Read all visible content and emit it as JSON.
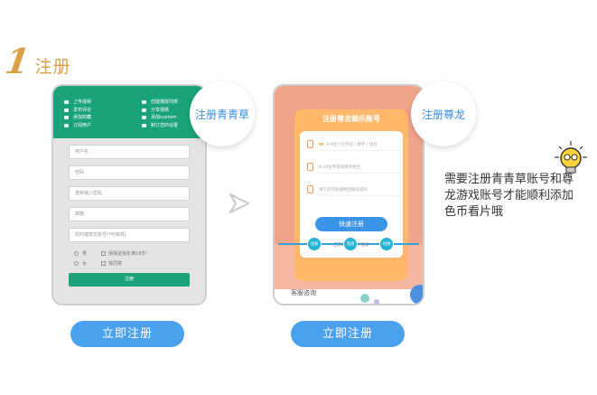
{
  "heading": {
    "number": "1",
    "title": "注册"
  },
  "phone1": {
    "menu_col1": [
      "上传视频",
      "发布评论",
      "添加收藏",
      "订阅用户"
    ],
    "menu_col2": [
      "创建播放列表",
      "分享视频",
      "添加custom",
      "制订您的设置"
    ],
    "inputs": [
      "用户名",
      "密码",
      "重新输入密码",
      "邮箱",
      "凯时或尊龙账号(*可填项)"
    ],
    "radio1": {
      "label": "男",
      "check_label": "我保证我年满18岁!"
    },
    "radio2": {
      "label": "女",
      "check_label": "我同意"
    },
    "submit": "注册",
    "bubble": "注册青青草"
  },
  "phone2": {
    "title": "注册尊龙娱乐账号",
    "fields": [
      {
        "prefix": "m",
        "placeholder": "4-9位小写字母 / 数字 / 组合"
      },
      {
        "prefix": "",
        "placeholder": "8-10位字母和数字组合"
      },
      {
        "prefix": "",
        "placeholder": "填写后可快速找回账号密码"
      }
    ],
    "quick_register": "快速注册",
    "has_account": "已有尊龙账号?",
    "login_link": "登录",
    "steps": [
      "注册",
      "充值",
      "兑换"
    ],
    "support": "客服咨询",
    "bubble": "注册尊龙"
  },
  "buttons": {
    "btn1": "立即注册",
    "btn2": "立即注册"
  },
  "note": "需要注册青青草账号和尊龙游戏账号才能顺利添加色币看片哦",
  "colors": {
    "accent": "#d9a046",
    "green": "#1aa37a",
    "blue": "#4aa1ee",
    "orange": "#ffb86a"
  }
}
